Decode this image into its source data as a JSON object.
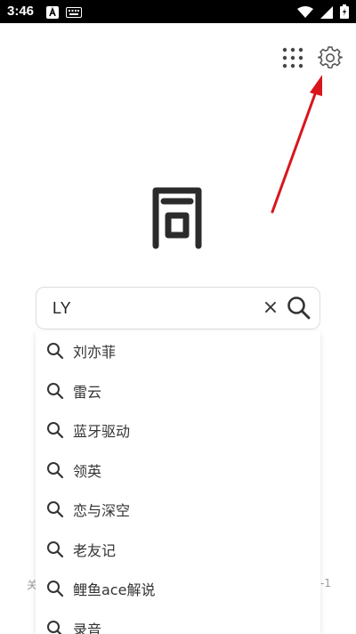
{
  "status_bar": {
    "time": "3:46"
  },
  "header": {
    "apps_icon": "apps-grid-icon",
    "settings_icon": "gear-icon",
    "arrow_color": "#d8161b"
  },
  "search": {
    "value": "LY",
    "clear_glyph": "×"
  },
  "footer": {
    "left_text": "关",
    "right_text": "-1"
  },
  "suggestions": [
    "刘亦菲",
    "雷云",
    "蓝牙驱动",
    "领英",
    "恋与深空",
    "老友记",
    "鲤鱼ace解说",
    "录音"
  ]
}
